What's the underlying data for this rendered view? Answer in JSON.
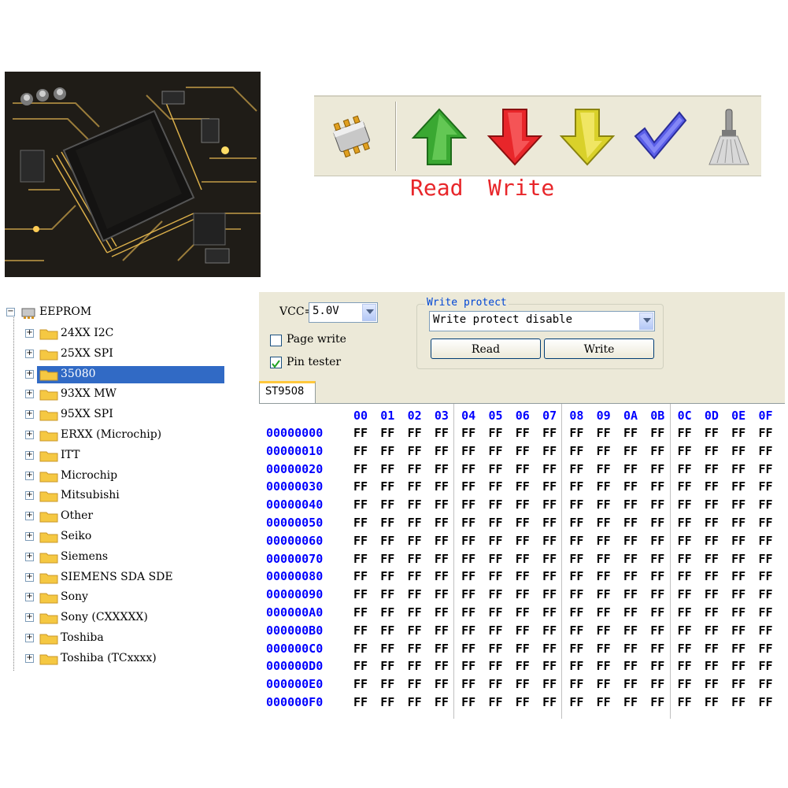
{
  "toolbar": {
    "buttons": [
      {
        "icon": "chip-icon"
      },
      {
        "icon": "read-arrow-icon",
        "color": "#3aa832"
      },
      {
        "icon": "write-arrow-icon",
        "color": "#e8262a"
      },
      {
        "icon": "verify-arrow-icon",
        "color": "#d9d12a"
      },
      {
        "icon": "check-icon",
        "color": "#5a5ee8"
      },
      {
        "icon": "erase-brush-icon"
      }
    ],
    "read_label": "Read",
    "write_label": "Write",
    "label_color": "#e8262a"
  },
  "tree": {
    "root": "EEPROM",
    "items": [
      "24XX I2C",
      "25XX SPI",
      "35080",
      "93XX MW",
      "95XX SPI",
      "ERXX (Microchip)",
      "ITT",
      "Microchip",
      "Mitsubishi",
      "Other",
      "Seiko",
      "Siemens",
      "SIEMENS SDA SDE",
      "Sony",
      "Sony (CXXXXX)",
      "Toshiba",
      "Toshiba (TCxxxx)"
    ],
    "selected": "35080"
  },
  "settings": {
    "vcc_label": "VCC=",
    "vcc_value": "5.0V",
    "page_write_label": "Page write",
    "page_write_checked": false,
    "pin_tester_label": "Pin tester",
    "pin_tester_checked": true,
    "write_protect": {
      "title": "Write protect",
      "value": "Write protect disable",
      "read_button": "Read",
      "write_button": "Write"
    }
  },
  "tab": {
    "label": "ST9508"
  },
  "hex": {
    "columns": [
      "00",
      "01",
      "02",
      "03",
      "04",
      "05",
      "06",
      "07",
      "08",
      "09",
      "0A",
      "0B",
      "0C",
      "0D",
      "0E",
      "0F"
    ],
    "rows": [
      {
        "addr": "00000000",
        "bytes": [
          "FF",
          "FF",
          "FF",
          "FF",
          "FF",
          "FF",
          "FF",
          "FF",
          "FF",
          "FF",
          "FF",
          "FF",
          "FF",
          "FF",
          "FF",
          "FF"
        ]
      },
      {
        "addr": "00000010",
        "bytes": [
          "FF",
          "FF",
          "FF",
          "FF",
          "FF",
          "FF",
          "FF",
          "FF",
          "FF",
          "FF",
          "FF",
          "FF",
          "FF",
          "FF",
          "FF",
          "FF"
        ]
      },
      {
        "addr": "00000020",
        "bytes": [
          "FF",
          "FF",
          "FF",
          "FF",
          "FF",
          "FF",
          "FF",
          "FF",
          "FF",
          "FF",
          "FF",
          "FF",
          "FF",
          "FF",
          "FF",
          "FF"
        ]
      },
      {
        "addr": "00000030",
        "bytes": [
          "FF",
          "FF",
          "FF",
          "FF",
          "FF",
          "FF",
          "FF",
          "FF",
          "FF",
          "FF",
          "FF",
          "FF",
          "FF",
          "FF",
          "FF",
          "FF"
        ]
      },
      {
        "addr": "00000040",
        "bytes": [
          "FF",
          "FF",
          "FF",
          "FF",
          "FF",
          "FF",
          "FF",
          "FF",
          "FF",
          "FF",
          "FF",
          "FF",
          "FF",
          "FF",
          "FF",
          "FF"
        ]
      },
      {
        "addr": "00000050",
        "bytes": [
          "FF",
          "FF",
          "FF",
          "FF",
          "FF",
          "FF",
          "FF",
          "FF",
          "FF",
          "FF",
          "FF",
          "FF",
          "FF",
          "FF",
          "FF",
          "FF"
        ]
      },
      {
        "addr": "00000060",
        "bytes": [
          "FF",
          "FF",
          "FF",
          "FF",
          "FF",
          "FF",
          "FF",
          "FF",
          "FF",
          "FF",
          "FF",
          "FF",
          "FF",
          "FF",
          "FF",
          "FF"
        ]
      },
      {
        "addr": "00000070",
        "bytes": [
          "FF",
          "FF",
          "FF",
          "FF",
          "FF",
          "FF",
          "FF",
          "FF",
          "FF",
          "FF",
          "FF",
          "FF",
          "FF",
          "FF",
          "FF",
          "FF"
        ]
      },
      {
        "addr": "00000080",
        "bytes": [
          "FF",
          "FF",
          "FF",
          "FF",
          "FF",
          "FF",
          "FF",
          "FF",
          "FF",
          "FF",
          "FF",
          "FF",
          "FF",
          "FF",
          "FF",
          "FF"
        ]
      },
      {
        "addr": "00000090",
        "bytes": [
          "FF",
          "FF",
          "FF",
          "FF",
          "FF",
          "FF",
          "FF",
          "FF",
          "FF",
          "FF",
          "FF",
          "FF",
          "FF",
          "FF",
          "FF",
          "FF"
        ]
      },
      {
        "addr": "000000A0",
        "bytes": [
          "FF",
          "FF",
          "FF",
          "FF",
          "FF",
          "FF",
          "FF",
          "FF",
          "FF",
          "FF",
          "FF",
          "FF",
          "FF",
          "FF",
          "FF",
          "FF"
        ]
      },
      {
        "addr": "000000B0",
        "bytes": [
          "FF",
          "FF",
          "FF",
          "FF",
          "FF",
          "FF",
          "FF",
          "FF",
          "FF",
          "FF",
          "FF",
          "FF",
          "FF",
          "FF",
          "FF",
          "FF"
        ]
      },
      {
        "addr": "000000C0",
        "bytes": [
          "FF",
          "FF",
          "FF",
          "FF",
          "FF",
          "FF",
          "FF",
          "FF",
          "FF",
          "FF",
          "FF",
          "FF",
          "FF",
          "FF",
          "FF",
          "FF"
        ]
      },
      {
        "addr": "000000D0",
        "bytes": [
          "FF",
          "FF",
          "FF",
          "FF",
          "FF",
          "FF",
          "FF",
          "FF",
          "FF",
          "FF",
          "FF",
          "FF",
          "FF",
          "FF",
          "FF",
          "FF"
        ]
      },
      {
        "addr": "000000E0",
        "bytes": [
          "FF",
          "FF",
          "FF",
          "FF",
          "FF",
          "FF",
          "FF",
          "FF",
          "FF",
          "FF",
          "FF",
          "FF",
          "FF",
          "FF",
          "FF",
          "FF"
        ]
      },
      {
        "addr": "000000F0",
        "bytes": [
          "FF",
          "FF",
          "FF",
          "FF",
          "FF",
          "FF",
          "FF",
          "FF",
          "FF",
          "FF",
          "FF",
          "FF",
          "FF",
          "FF",
          "FF",
          "FF"
        ]
      }
    ]
  }
}
